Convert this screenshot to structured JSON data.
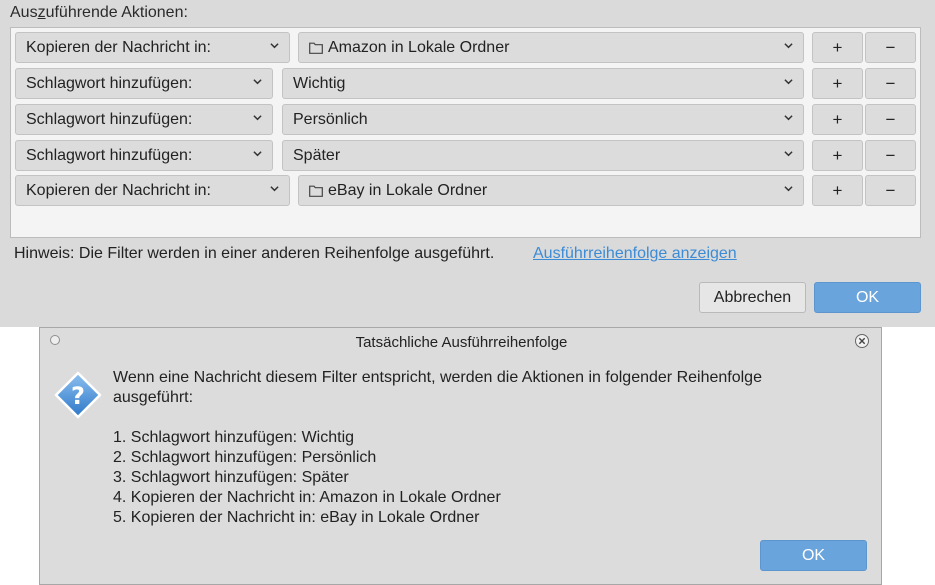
{
  "main": {
    "section_label_pre": "Aus",
    "section_label_ul": "z",
    "section_label_post": "uführende Aktionen:",
    "rows": [
      {
        "action": "Kopieren der Nachricht in:",
        "value": "Amazon in Lokale Ordner",
        "has_folder_icon": true
      },
      {
        "action": "Schlagwort hinzufügen:",
        "value": "Wichtig",
        "has_folder_icon": false
      },
      {
        "action": "Schlagwort hinzufügen:",
        "value": "Persönlich",
        "has_folder_icon": false
      },
      {
        "action": "Schlagwort hinzufügen:",
        "value": "Später",
        "has_folder_icon": false
      },
      {
        "action": "Kopieren der Nachricht in:",
        "value": "eBay in Lokale Ordner",
        "has_folder_icon": true
      }
    ],
    "add_label": "+",
    "remove_label": "−",
    "hint_text": "Hinweis: Die Filter werden in einer anderen Reihenfolge ausgeführt.",
    "hint_link": "Ausführreihenfolge anzeigen",
    "cancel_label": "Abbrechen",
    "ok_label": "OK"
  },
  "dialog": {
    "title": "Tatsächliche Ausführreihenfolge",
    "message_line1": "Wenn eine Nachricht diesem Filter entspricht, werden die Aktionen in folgender Reihenfolge",
    "message_line2": "ausgeführt:",
    "list": [
      "1. Schlagwort hinzufügen: Wichtig",
      "2. Schlagwort hinzufügen: Persönlich",
      "3. Schlagwort hinzufügen: Später",
      "4. Kopieren der Nachricht in: Amazon in Lokale Ordner",
      "5. Kopieren der Nachricht in: eBay in Lokale Ordner"
    ],
    "ok_label": "OK",
    "icon": "question-icon"
  },
  "colors": {
    "accent": "#6aa4dc",
    "link": "#3c8bd6",
    "panel_bg": "#dadada"
  }
}
